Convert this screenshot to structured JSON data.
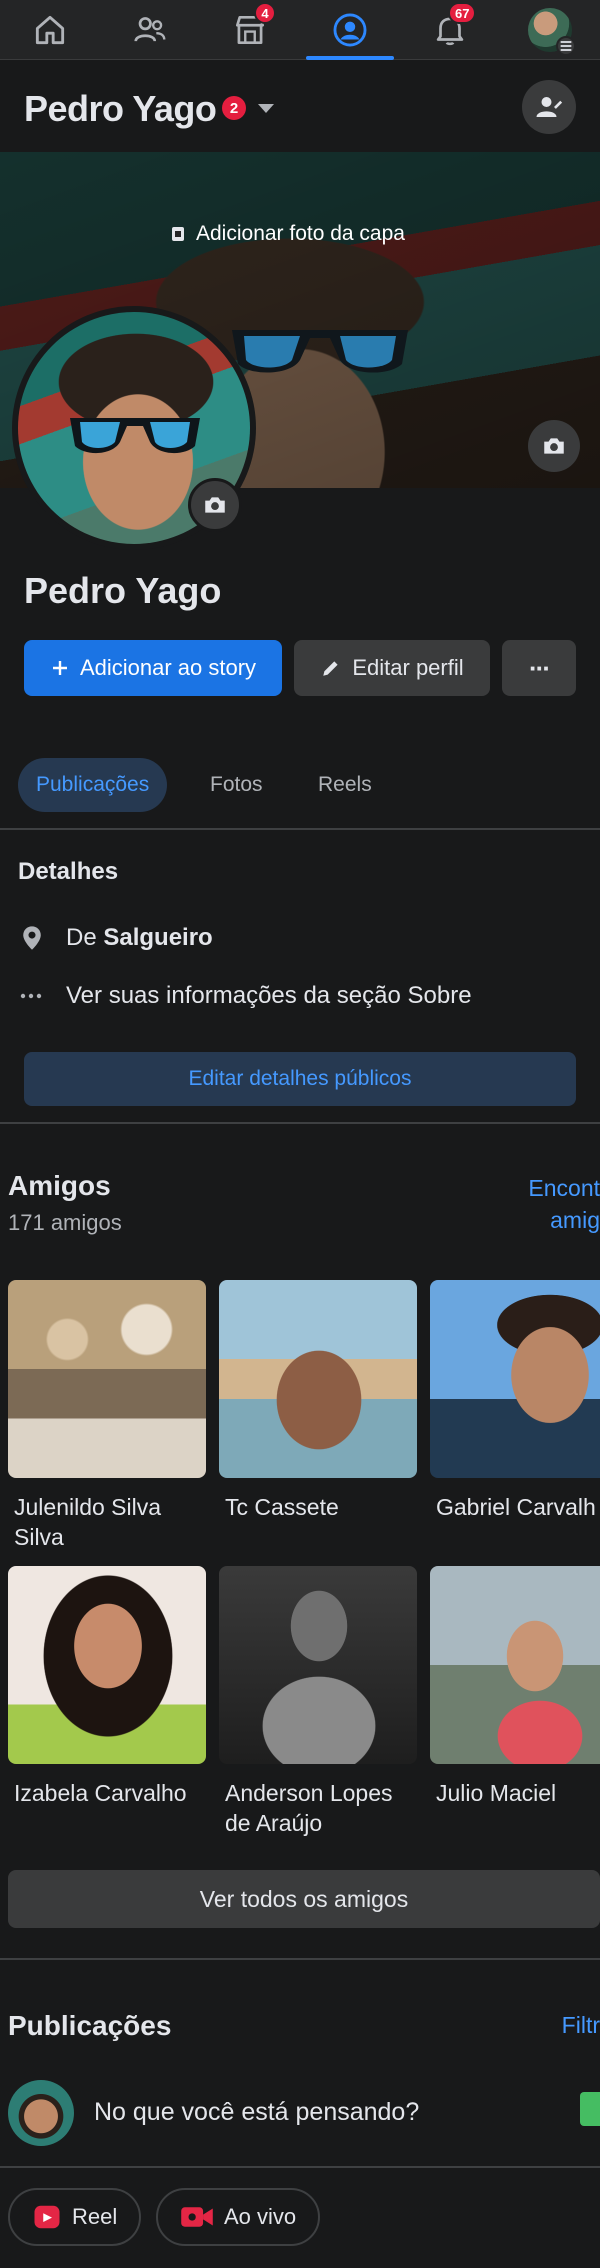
{
  "nav": {
    "marketplace_badge": "4",
    "notifications_badge": "67"
  },
  "header": {
    "name": "Pedro Yago",
    "badge": "2"
  },
  "cover": {
    "add_cover_label": "Adicionar foto da capa"
  },
  "profile": {
    "name": "Pedro Yago",
    "add_story_label": "Adicionar ao story",
    "edit_profile_label": "Editar perfil",
    "more_label": "···"
  },
  "tabs": [
    {
      "label": "Publicações",
      "active": true
    },
    {
      "label": "Fotos",
      "active": false
    },
    {
      "label": "Reels",
      "active": false
    }
  ],
  "details": {
    "title": "Detalhes",
    "from_prefix": "De",
    "from_city": "Salgueiro",
    "about_label": "Ver suas informações da seção Sobre",
    "edit_label": "Editar detalhes públicos"
  },
  "friends": {
    "title": "Amigos",
    "count": "171 amigos",
    "find_label_line1": "Encont",
    "find_label_line2": "amig",
    "items": [
      {
        "name": "Julenildo Silva Silva"
      },
      {
        "name": "Tc Cassete"
      },
      {
        "name": "Gabriel Carvalh"
      },
      {
        "name": "Izabela Carvalho"
      },
      {
        "name": "Anderson Lopes de Araújo"
      },
      {
        "name": "Julio Maciel"
      }
    ],
    "see_all_label": "Ver todos os amigos"
  },
  "publications": {
    "title": "Publicações",
    "filter_label": "Filtr",
    "prompt": "No que você está pensando?",
    "reel_label": "Reel",
    "live_label": "Ao vivo"
  },
  "colors": {
    "accent": "#1b74e4",
    "link": "#4599ff",
    "badge": "#e41e3f",
    "surface": "#18191a"
  }
}
